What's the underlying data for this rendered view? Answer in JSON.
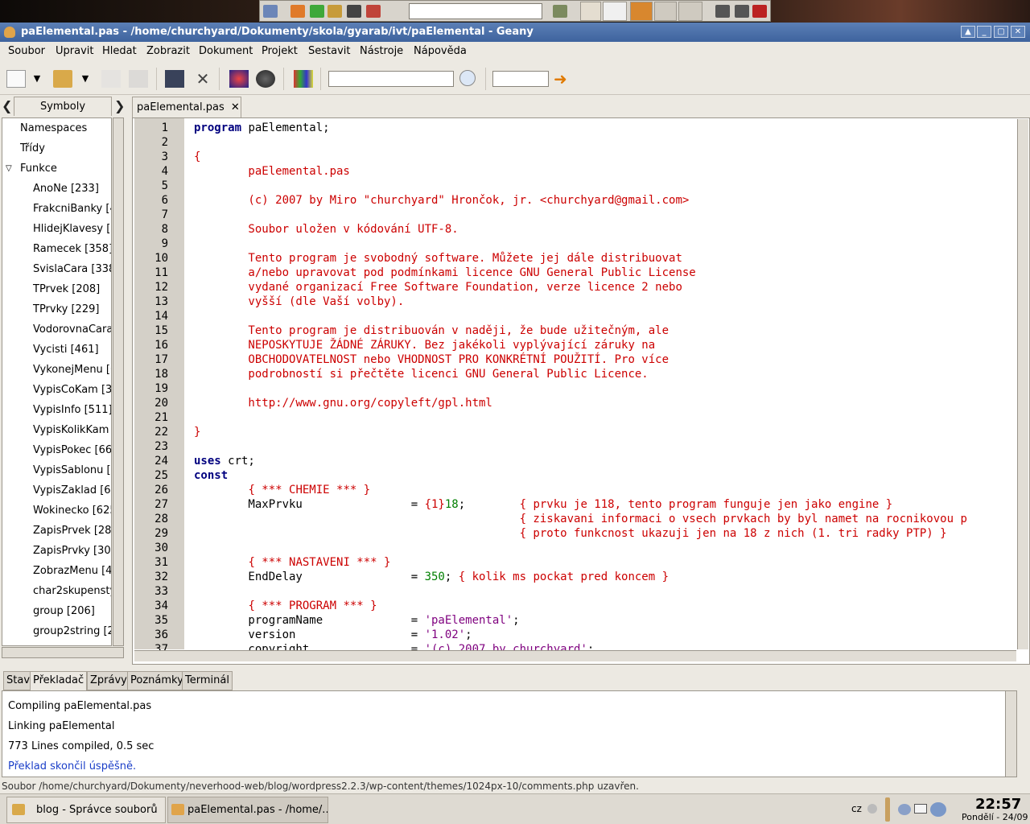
{
  "window": {
    "title": "paElemental.pas - /home/churchyard/Dokumenty/skola/gyarab/ivt/paElemental - Geany"
  },
  "menubar": [
    "Soubor",
    "Upravit",
    "Hledat",
    "Zobrazit",
    "Dokument",
    "Projekt",
    "Sestavit",
    "Nástroje",
    "Nápověda"
  ],
  "sidebar": {
    "tab_label": "Symboly",
    "items": [
      "Namespaces",
      "Třídy",
      "Funkce",
      "AnoNe [233]",
      "FrakcniBanky [4",
      "HlidejKlavesy [7",
      "Ramecek [358]",
      "SvislaCara [338",
      "TPrvek [208]",
      "TPrvky [229]",
      "VodorovnaCara",
      "Vycisti [461]",
      "VykonejMenu [6",
      "VypisCoKam [3",
      "VypisInfo [511]",
      "VypisKolikKam",
      "VypisPokec [66",
      "VypisSablonu [",
      "VypisZaklad [6",
      "Wokinecko [625",
      "ZapisPrvek [28",
      "ZapisPrvky [30",
      "ZobrazMenu [4",
      "char2skupensty",
      "group [206]",
      "group2string [2"
    ]
  },
  "editor": {
    "tab_label": "paElemental.pas",
    "lines": [
      "program paElemental;",
      "",
      "{",
      "        paElemental.pas",
      "",
      "        (c) 2007 by Miro \"churchyard\" Hrončok, jr. <churchyard@gmail.com>",
      "",
      "        Soubor uložen v kódování UTF-8.",
      "",
      "        Tento program je svobodný software. Můžete jej dále distribuovat",
      "        a/nebo upravovat pod podmínkami licence GNU General Public License",
      "        vydané organizací Free Software Foundation, verze licence 2 nebo",
      "        vyšší (dle Vaší volby).",
      "",
      "        Tento program je distribuován v naději, že bude užitečným, ale",
      "        NEPOSKYTUJE ŽÁDNÉ ZÁRUKY. Bez jakékoli vyplývající záruky na",
      "        OBCHODOVATELNOST nebo VHODNOST PRO KONKRÉTNÍ POUŽITÍ. Pro více",
      "        podrobností si přečtěte licenci GNU General Public Licence.",
      "",
      "        http://www.gnu.org/copyleft/gpl.html",
      "",
      "}",
      "",
      "uses crt;",
      "const",
      "        { *** CHEMIE *** }",
      "        MaxPrvku                = {1}18;        { prvku je 118, tento program funguje jen jako engine }",
      "                                                { ziskavani informaci o vsech prvkach by byl namet na rocnikovou p",
      "                                                { proto funkcnost ukazuji jen na 18 z nich (1. tri radky PTP) }",
      "",
      "        { *** NASTAVENI *** }",
      "        EndDelay                = 350; { kolik ms pockat pred koncem }",
      "",
      "        { *** PROGRAM *** }",
      "        programName             = 'paElemental';",
      "        version                 = '1.02';",
      "        copyright               = '(c) 2007 by churchyard';"
    ]
  },
  "messages": {
    "tabs": [
      "Stav",
      "Překladač",
      "Zprávy",
      "Poznámky",
      "Terminál"
    ],
    "lines": [
      "Compiling paElemental.pas",
      "Linking paElemental",
      "773 Lines compiled, 0.5 sec",
      "Překlad skončil úspěšně."
    ]
  },
  "statusbar": {
    "text": "Soubor /home/churchyard/Dokumenty/neverhood-web/blog/wordpress2.2.3/wp-content/themes/1024px-10/comments.php uzavřen."
  },
  "taskbar": {
    "tasks": [
      "blog - Správce souborů",
      "paElemental.pas - /home/..."
    ],
    "keyboard": "cz",
    "clock": "22:57",
    "date": "Pondělí - 24/09"
  }
}
